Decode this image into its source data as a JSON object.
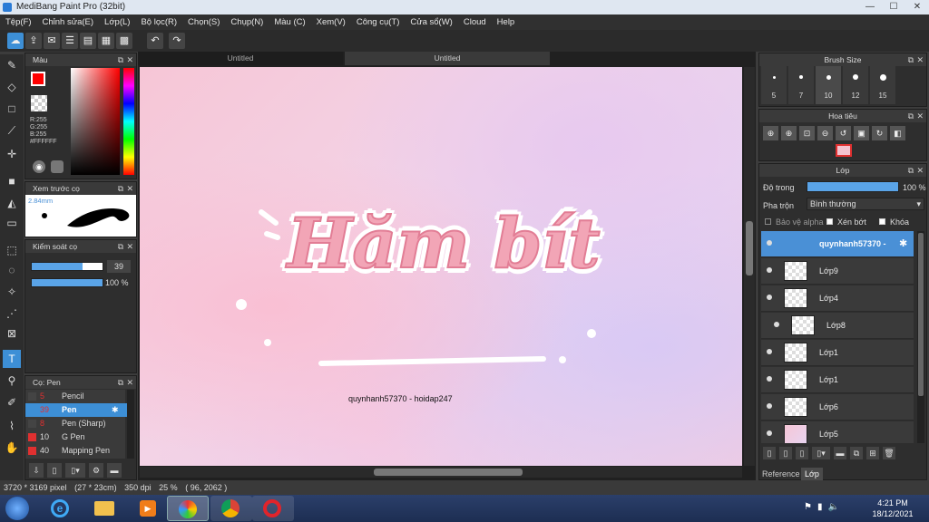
{
  "window": {
    "title": "MediBang Paint Pro (32bit)",
    "min_glyph": "—",
    "max_glyph": "☐",
    "close_glyph": "✕"
  },
  "menu": [
    "Tệp(F)",
    "Chỉnh sửa(E)",
    "Lớp(L)",
    "Bộ lọc(R)",
    "Chọn(S)",
    "Chụp(N)",
    "Màu (C)",
    "Xem(V)",
    "Công cụ(T)",
    "Cửa sổ(W)",
    "Cloud",
    "Help"
  ],
  "toolbar": {
    "undo_glyph": "↶",
    "redo_glyph": "↷"
  },
  "color_panel": {
    "title": "Màu",
    "r": "R:255",
    "g": "G:255",
    "b": "B:255",
    "hex": "#FFFFFF",
    "primary_color": "#ff0000",
    "secondary_color": "#ffffff"
  },
  "brush_preview": {
    "title": "Xem trước cọ",
    "size": "2.84mm"
  },
  "brush_control": {
    "title": "Kiểm soát cọ",
    "size_value": "39",
    "opacity_value": "100 %",
    "size_fill": 0.72,
    "opacity_fill": 1.0
  },
  "brush_list": {
    "title": "Cọ: Pen",
    "items": [
      {
        "num": "5",
        "name": "Pencil",
        "color": "#444444",
        "selected": false
      },
      {
        "num": "39",
        "name": "Pen",
        "color": "#3d8fd6",
        "selected": true
      },
      {
        "num": "8",
        "name": "Pen (Sharp)",
        "color": "#444444",
        "selected": false
      },
      {
        "num": "10",
        "name": "G Pen",
        "color": "#e03030",
        "selected": false
      },
      {
        "num": "40",
        "name": "Mapping Pen",
        "color": "#e03030",
        "selected": false
      }
    ]
  },
  "tabs": [
    "Untitled",
    "Untitled"
  ],
  "canvas": {
    "title_art": "Hăm bít",
    "watermark": "quynhanh57370 - hoidap247"
  },
  "brush_size": {
    "title": "Brush Size",
    "sizes": [
      "5",
      "7",
      "10",
      "12",
      "15"
    ]
  },
  "navigator": {
    "title": "Hoa tiêu"
  },
  "layers": {
    "title": "Lớp",
    "opacity_label": "Độ trong",
    "opacity_value": "100 %",
    "blend_label": "Pha trộn",
    "blend_value": "Bình thường",
    "protect_alpha": "Bảo vệ alpha",
    "clipping": "Xén bớt",
    "lock": "Khóa",
    "items": [
      {
        "name": "quynhanh57370 -",
        "active": true,
        "indent": false
      },
      {
        "name": "Lớp9",
        "active": false,
        "indent": false
      },
      {
        "name": "Lớp4",
        "active": false,
        "indent": false
      },
      {
        "name": "Lớp8",
        "active": false,
        "indent": true
      },
      {
        "name": "Lớp1",
        "active": false,
        "indent": false
      },
      {
        "name": "Lớp1",
        "active": false,
        "indent": false
      },
      {
        "name": "Lớp6",
        "active": false,
        "indent": false
      },
      {
        "name": "Lớp5",
        "active": false,
        "indent": false
      }
    ],
    "bottom_tabs": [
      "Reference",
      "Lớp"
    ]
  },
  "status": {
    "dimensions": "3720 * 3169 pixel",
    "physical": "(27 * 23cm)",
    "dpi": "350 dpi",
    "zoom": "25 %",
    "coords": "( 96, 2062 )"
  },
  "taskbar": {
    "time": "4:21 PM",
    "date": "18/12/2021"
  }
}
